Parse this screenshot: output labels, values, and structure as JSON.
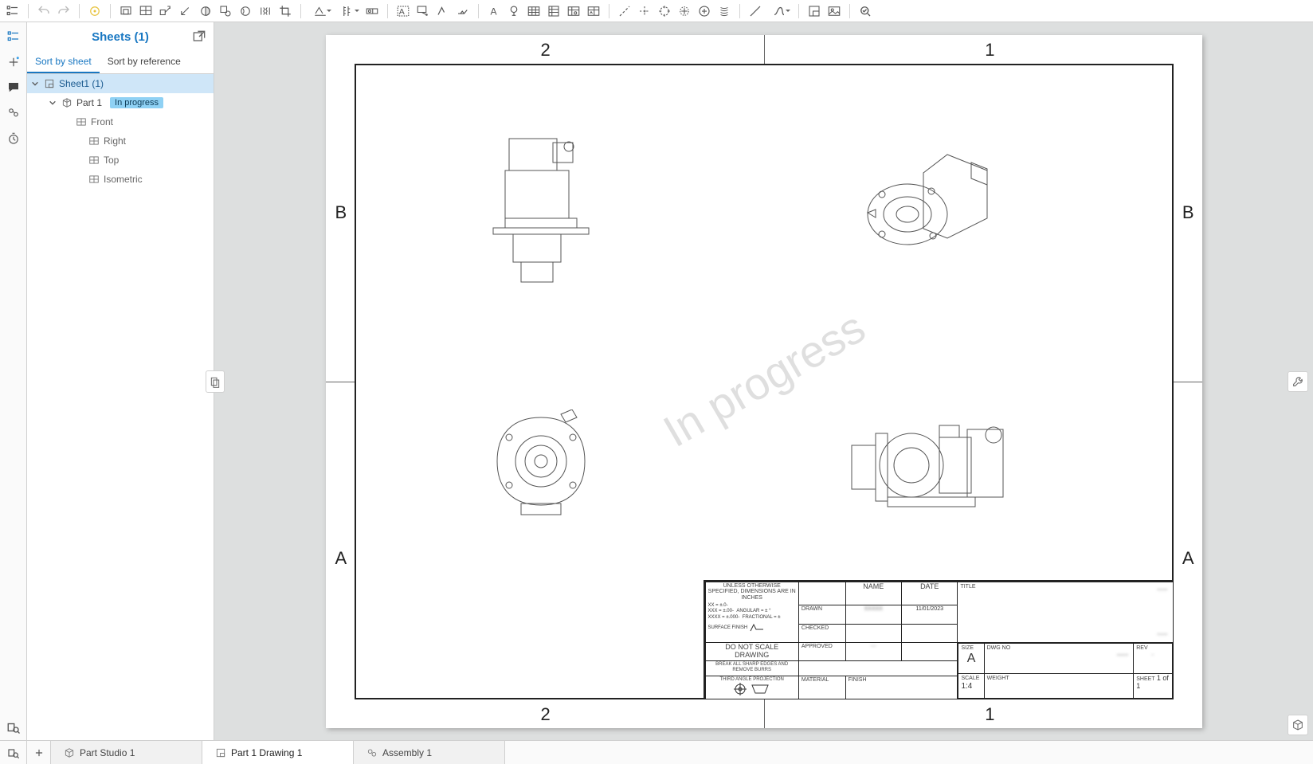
{
  "panel": {
    "title": "Sheets (1)",
    "tabs": {
      "bySheet": "Sort by sheet",
      "byRef": "Sort by reference"
    }
  },
  "tree": {
    "sheet": "Sheet1 (1)",
    "part": "Part 1",
    "badge": "In progress",
    "views": [
      "Front",
      "Right",
      "Top",
      "Isometric"
    ]
  },
  "drawing": {
    "zones": {
      "cols": [
        "2",
        "1"
      ],
      "rows": [
        "B",
        "A"
      ]
    },
    "watermark": "In progress",
    "tolerances_title": "UNLESS OTHERWISE SPECIFIED, DIMENSIONS ARE IN INCHES",
    "tol_lines": [
      "XX = ±.0-",
      "XXX = ±.00-",
      "XXXX = ±.000-",
      "ANGULAR = ± °",
      "FRACTIONAL = ±"
    ],
    "surface_finish": "SURFACE FINISH",
    "do_not_scale": "DO NOT SCALE DRAWING",
    "deburr": "BREAK ALL SHARP EDGES AND REMOVE BURRS",
    "third_angle": "THIRD ANGLE PROJECTION",
    "material_label": "MATERIAL",
    "finish_label": "FINISH",
    "name_label": "NAME",
    "date_label": "DATE",
    "drawn_label": "DRAWN",
    "checked_label": "CHECKED",
    "approved_label": "APPROVED",
    "title_label": "TITLE",
    "size_label": "SIZE",
    "size_value": "A",
    "dwgno_label": "DWG NO",
    "rev_label": "REV",
    "scale_label": "SCALE",
    "scale_value": "1:4",
    "weight_label": "WEIGHT",
    "sheet_label": "SHEET",
    "sheet_value": "1 of 1",
    "drawn_name": "XXXXX",
    "drawn_date": "11/01/2023"
  },
  "tabs": {
    "studio": "Part Studio 1",
    "drawing": "Part 1 Drawing 1",
    "assembly": "Assembly 1"
  }
}
